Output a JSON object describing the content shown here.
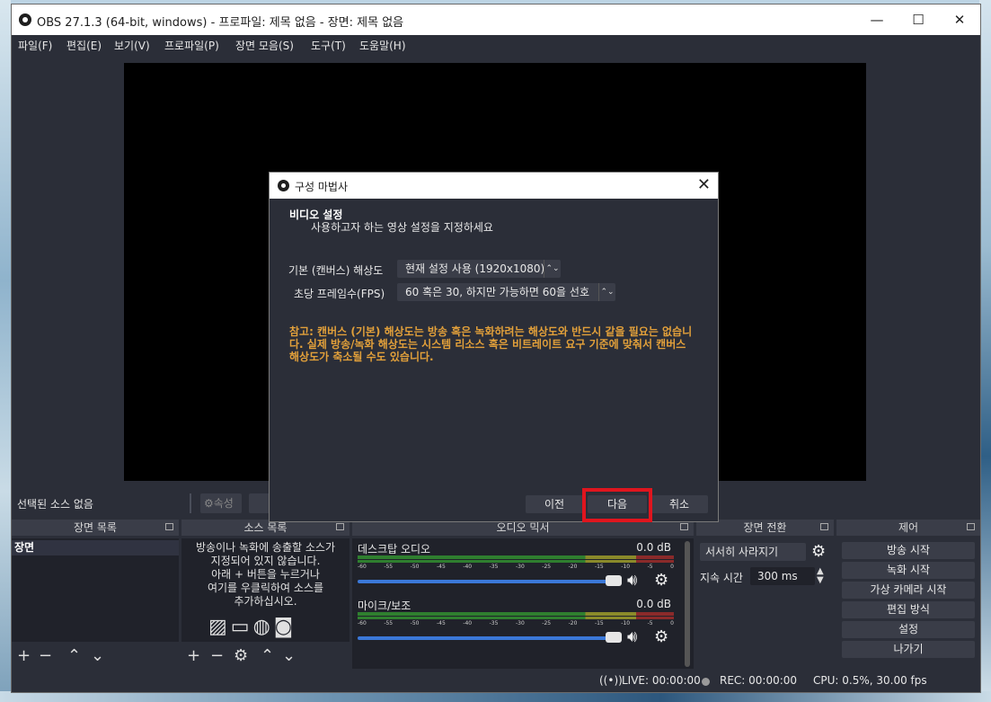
{
  "window": {
    "title": "OBS 27.1.3 (64-bit, windows) - 프로파일: 제목 없음 - 장면: 제목 없음",
    "minimize": "—",
    "maximize": "☐",
    "close": "✕"
  },
  "menu": [
    "파일(F)",
    "편집(E)",
    "보기(V)",
    "프로파일(P)",
    "장면 모음(S)",
    "도구(T)",
    "도움말(H)"
  ],
  "toolbar": {
    "no_source": "선택된 소스 없음",
    "properties_label": "속성"
  },
  "docks": {
    "scenes": {
      "title": "장면 목록",
      "items": [
        "장면"
      ]
    },
    "sources": {
      "title": "소스 목록",
      "hint_lines": [
        "방송이나 녹화에 송출할 소스가",
        "지정되어 있지 않습니다.",
        "아래 + 버튼을 누르거나",
        "여기를 우클릭하여 소스를",
        "추가하십시오."
      ]
    },
    "mixer": {
      "title": "오디오 믹서",
      "ticks": [
        "-60",
        "-55",
        "-50",
        "-45",
        "-40",
        "-35",
        "-30",
        "-25",
        "-20",
        "-15",
        "-10",
        "-5",
        "0"
      ],
      "channels": [
        {
          "name": "데스크탑 오디오",
          "level": "0.0 dB"
        },
        {
          "name": "마이크/보조",
          "level": "0.0 dB"
        }
      ]
    },
    "transitions": {
      "title": "장면 전환",
      "selected": "서서히 사라지기",
      "duration_label": "지속 시간",
      "duration": "300 ms"
    },
    "controls": {
      "title": "제어",
      "buttons": [
        "방송 시작",
        "녹화 시작",
        "가상 카메라 시작",
        "편집 방식",
        "설정",
        "나가기"
      ]
    }
  },
  "status": {
    "live": "LIVE: 00:00:00",
    "rec": "REC: 00:00:00",
    "cpu": "CPU: 0.5%, 30.00 fps"
  },
  "dialog": {
    "title": "구성 마법사",
    "heading": "비디오 설정",
    "subheading": "사용하고자 하는 영상 설정을 지정하세요",
    "base_res_label": "기본 (캔버스) 해상도",
    "base_res_value": "현재 설정 사용 (1920x1080)",
    "fps_label": "초당 프레임수(FPS)",
    "fps_value": "60 혹은 30, 하지만 가능하면 60을 선호",
    "note": "참고: 캔버스 (기본) 해상도는 방송 혹은 녹화하려는 해상도와 반드시 같을 필요는 없습니다. 실제 방송/녹화 해상도는 시스템 리소스 혹은 비트레이트 요구 기준에 맞춰서 캔버스 해상도가 축소될 수도 있습니다.",
    "btn_prev": "이전",
    "btn_next": "다음",
    "btn_cancel": "취소"
  },
  "colors": {
    "panel_bg": "#2b2e38",
    "dock_body": "#20222a",
    "note": "#e2a03a",
    "highlight": "#e0151e",
    "slider": "#3b78d8"
  }
}
